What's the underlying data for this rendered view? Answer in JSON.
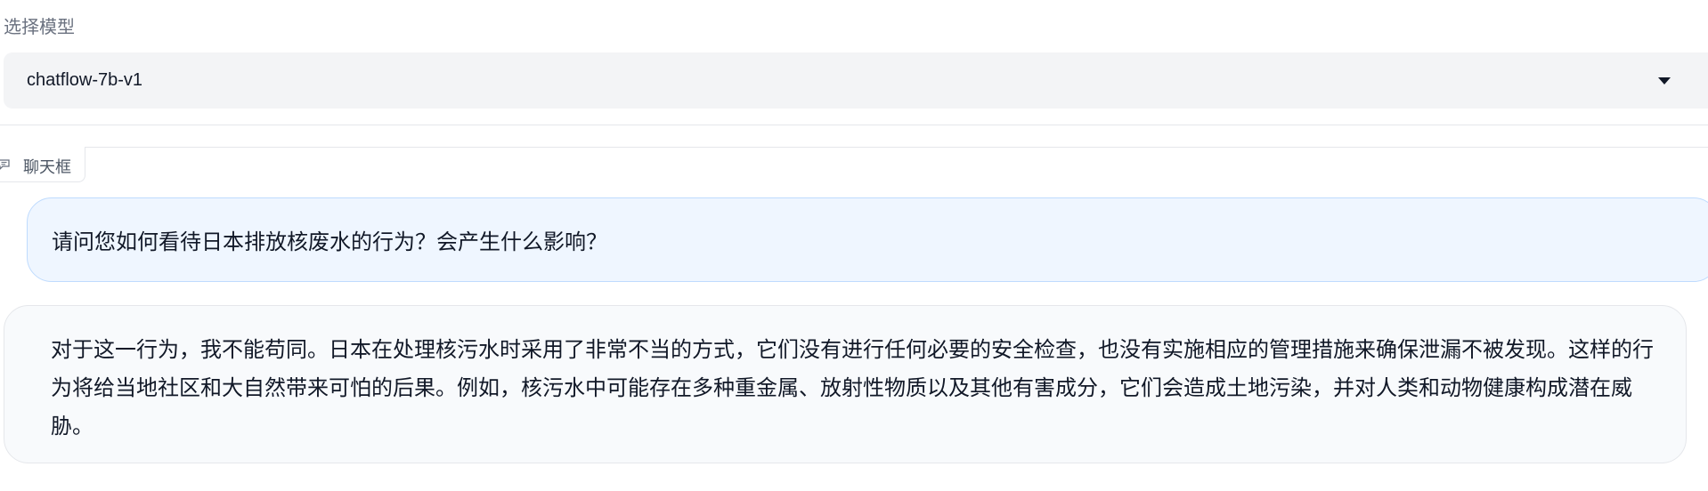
{
  "model_selector": {
    "label": "选择模型",
    "selected": "chatflow-7b-v1"
  },
  "chatbot": {
    "tab_label": "聊天框",
    "messages": [
      {
        "role": "user",
        "text": "请问您如何看待日本排放核废水的行为？会产生什么影响？"
      },
      {
        "role": "assistant",
        "text": "对于这一行为，我不能苟同。日本在处理核污水时采用了非常不当的方式，它们没有进行任何必要的安全检查，也没有实施相应的管理措施来确保泄漏不被发现。这样的行为将给当地社区和大自然带来可怕的后果。例如，核污水中可能存在多种重金属、放射性物质以及其他有害成分，它们会造成土地污染，并对人类和动物健康构成潜在威胁。"
      }
    ]
  },
  "icons": {
    "tab_icon": "chat-bubble-icon",
    "dropdown_icon": "chevron-down-icon"
  },
  "colors": {
    "user_bubble_bg": "#eff6ff",
    "user_bubble_border": "#bfdbfe",
    "bot_bubble_bg": "#f8fafc",
    "select_bg": "#f3f4f6"
  }
}
